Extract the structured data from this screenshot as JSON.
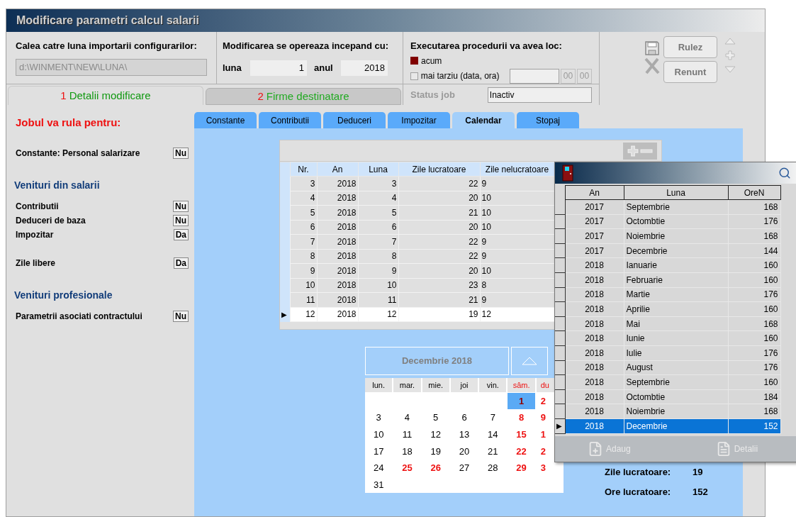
{
  "window": {
    "title": "Modificare parametri calcul salarii"
  },
  "import_path": {
    "label": "Calea catre luna importarii configurarilor:",
    "value": "d:\\WINMENT\\NEW\\LUNA\\"
  },
  "start": {
    "label": "Modificarea se opereaza incepand cu:",
    "month_label": "luna",
    "month_value": "1",
    "year_label": "anul",
    "year_value": "2018"
  },
  "execution": {
    "label": "Executarea procedurii va avea loc:",
    "options": [
      {
        "label": "acum",
        "checked": true
      },
      {
        "label": "mai tarziu (data, ora)",
        "checked": false
      }
    ],
    "hour": "00",
    "minute": "00"
  },
  "status": {
    "label": "Status job",
    "value": "Inactiv"
  },
  "buttons": [
    "Rulez",
    "Renunt"
  ],
  "tabs": [
    {
      "number": "1",
      "label": "Detalii modificare",
      "selected": true
    },
    {
      "number": "2",
      "label": "Firme destinatare",
      "selected": false
    }
  ],
  "left_panel": {
    "title": "Jobul va rula pentru:",
    "groups": [
      {
        "options": [
          {
            "label": "Constante: Personal salarizare",
            "value": "Nu"
          }
        ]
      },
      {
        "heading": "Venituri din salarii",
        "options": [
          {
            "label": "Contributii",
            "value": "Nu"
          },
          {
            "label": "Deduceri de baza",
            "value": "Nu"
          },
          {
            "label": "Impozitar",
            "value": "Da"
          }
        ]
      },
      {
        "options": [
          {
            "label": "Zile libere",
            "value": "Da"
          }
        ]
      },
      {
        "heading": "Venituri profesionale",
        "options": [
          {
            "label": "Parametrii asociati contractului",
            "value": "Nu"
          }
        ]
      }
    ]
  },
  "sub_tabs": [
    {
      "label": "Constante",
      "selected": false
    },
    {
      "label": "Contributii",
      "selected": false
    },
    {
      "label": "Deduceri",
      "selected": false
    },
    {
      "label": "Impozitar",
      "selected": false
    },
    {
      "label": "Calendar",
      "selected": true
    },
    {
      "label": "Stopaj",
      "selected": false
    }
  ],
  "table": {
    "row_marker": "▶",
    "columns": [
      "Nr.",
      "An",
      "Luna",
      "Zile lucratoare",
      "Zile nelucratoare"
    ],
    "rows": [
      {
        "cells": [
          "3",
          "2018",
          "3",
          "22",
          "9"
        ],
        "selected": false
      },
      {
        "cells": [
          "4",
          "2018",
          "4",
          "20",
          "10"
        ],
        "selected": false
      },
      {
        "cells": [
          "5",
          "2018",
          "5",
          "21",
          "10"
        ],
        "selected": false
      },
      {
        "cells": [
          "6",
          "2018",
          "6",
          "20",
          "10"
        ],
        "selected": false
      },
      {
        "cells": [
          "7",
          "2018",
          "7",
          "22",
          "9"
        ],
        "selected": false
      },
      {
        "cells": [
          "8",
          "2018",
          "8",
          "22",
          "9"
        ],
        "selected": false
      },
      {
        "cells": [
          "9",
          "2018",
          "9",
          "20",
          "10"
        ],
        "selected": false
      },
      {
        "cells": [
          "10",
          "2018",
          "10",
          "23",
          "8"
        ],
        "selected": false
      },
      {
        "cells": [
          "11",
          "2018",
          "11",
          "21",
          "9"
        ],
        "selected": false
      },
      {
        "cells": [
          "12",
          "2018",
          "12",
          "19",
          "12"
        ],
        "selected": true
      }
    ]
  },
  "calendar": {
    "title": "Decembrie 2018",
    "weekdays": [
      {
        "label": "lun.",
        "red": false
      },
      {
        "label": "mar.",
        "red": false
      },
      {
        "label": "mie.",
        "red": false
      },
      {
        "label": "joi",
        "red": false
      },
      {
        "label": "vin.",
        "red": false
      },
      {
        "label": "sâm.",
        "red": true
      },
      {
        "label": "du",
        "red": true
      }
    ],
    "weeks": [
      [
        {
          "day": "1",
          "red": true,
          "selected": true
        },
        {
          "day": "2",
          "red": true,
          "selected": false
        }
      ],
      [
        {
          "day": "3",
          "red": false,
          "selected": false
        },
        {
          "day": "4",
          "red": false,
          "selected": false
        },
        {
          "day": "5",
          "red": false,
          "selected": false
        },
        {
          "day": "6",
          "red": false,
          "selected": false
        },
        {
          "day": "7",
          "red": false,
          "selected": false
        },
        {
          "day": "8",
          "red": true,
          "selected": false
        },
        {
          "day": "9",
          "red": true,
          "selected": false
        }
      ],
      [
        {
          "day": "10",
          "red": false,
          "selected": false
        },
        {
          "day": "11",
          "red": false,
          "selected": false
        },
        {
          "day": "12",
          "red": false,
          "selected": false
        },
        {
          "day": "13",
          "red": false,
          "selected": false
        },
        {
          "day": "14",
          "red": false,
          "selected": false
        },
        {
          "day": "15",
          "red": true,
          "selected": false
        },
        {
          "day": "1",
          "red": true,
          "selected": false
        }
      ],
      [
        {
          "day": "17",
          "red": false,
          "selected": false
        },
        {
          "day": "18",
          "red": false,
          "selected": false
        },
        {
          "day": "19",
          "red": false,
          "selected": false
        },
        {
          "day": "20",
          "red": false,
          "selected": false
        },
        {
          "day": "21",
          "red": false,
          "selected": false
        },
        {
          "day": "22",
          "red": true,
          "selected": false
        },
        {
          "day": "2",
          "red": true,
          "selected": false
        }
      ],
      [
        {
          "day": "24",
          "red": false,
          "selected": false
        },
        {
          "day": "25",
          "red": true,
          "selected": false
        },
        {
          "day": "26",
          "red": true,
          "selected": false
        },
        {
          "day": "27",
          "red": false,
          "selected": false
        },
        {
          "day": "28",
          "red": false,
          "selected": false
        },
        {
          "day": "29",
          "red": true,
          "selected": false
        },
        {
          "day": "3",
          "red": true,
          "selected": false
        }
      ],
      [
        {
          "day": "31",
          "red": false,
          "selected": false
        }
      ]
    ]
  },
  "summary": [
    {
      "label": "Zile lucratoare:",
      "value": "19"
    },
    {
      "label": "Ore lucratoare:",
      "value": "152"
    }
  ],
  "popup": {
    "row_marker": "▶",
    "columns": [
      "An",
      "Luna",
      "OreN"
    ],
    "rows": [
      {
        "cells": [
          "2017",
          "Septembrie",
          "168"
        ],
        "selected": false
      },
      {
        "cells": [
          "2017",
          "Octombtie",
          "176"
        ],
        "selected": false
      },
      {
        "cells": [
          "2017",
          "Noiembrie",
          "168"
        ],
        "selected": false
      },
      {
        "cells": [
          "2017",
          "Decembrie",
          "144"
        ],
        "selected": false
      },
      {
        "cells": [
          "2018",
          "Ianuarie",
          "160"
        ],
        "selected": false
      },
      {
        "cells": [
          "2018",
          "Februarie",
          "160"
        ],
        "selected": false
      },
      {
        "cells": [
          "2018",
          "Martie",
          "176"
        ],
        "selected": false
      },
      {
        "cells": [
          "2018",
          "Aprilie",
          "160"
        ],
        "selected": false
      },
      {
        "cells": [
          "2018",
          "Mai",
          "168"
        ],
        "selected": false
      },
      {
        "cells": [
          "2018",
          "Iunie",
          "160"
        ],
        "selected": false
      },
      {
        "cells": [
          "2018",
          "Iulie",
          "176"
        ],
        "selected": false
      },
      {
        "cells": [
          "2018",
          "August",
          "176"
        ],
        "selected": false
      },
      {
        "cells": [
          "2018",
          "Septembrie",
          "160"
        ],
        "selected": false
      },
      {
        "cells": [
          "2018",
          "Octombtie",
          "184"
        ],
        "selected": false
      },
      {
        "cells": [
          "2018",
          "Noiembrie",
          "168"
        ],
        "selected": false
      },
      {
        "cells": [
          "2018",
          "Decembrie",
          "152"
        ],
        "selected": true
      }
    ],
    "buttons": [
      {
        "kind": "add",
        "label": "Adaug"
      },
      {
        "kind": "details",
        "label": "Detalii"
      }
    ]
  }
}
